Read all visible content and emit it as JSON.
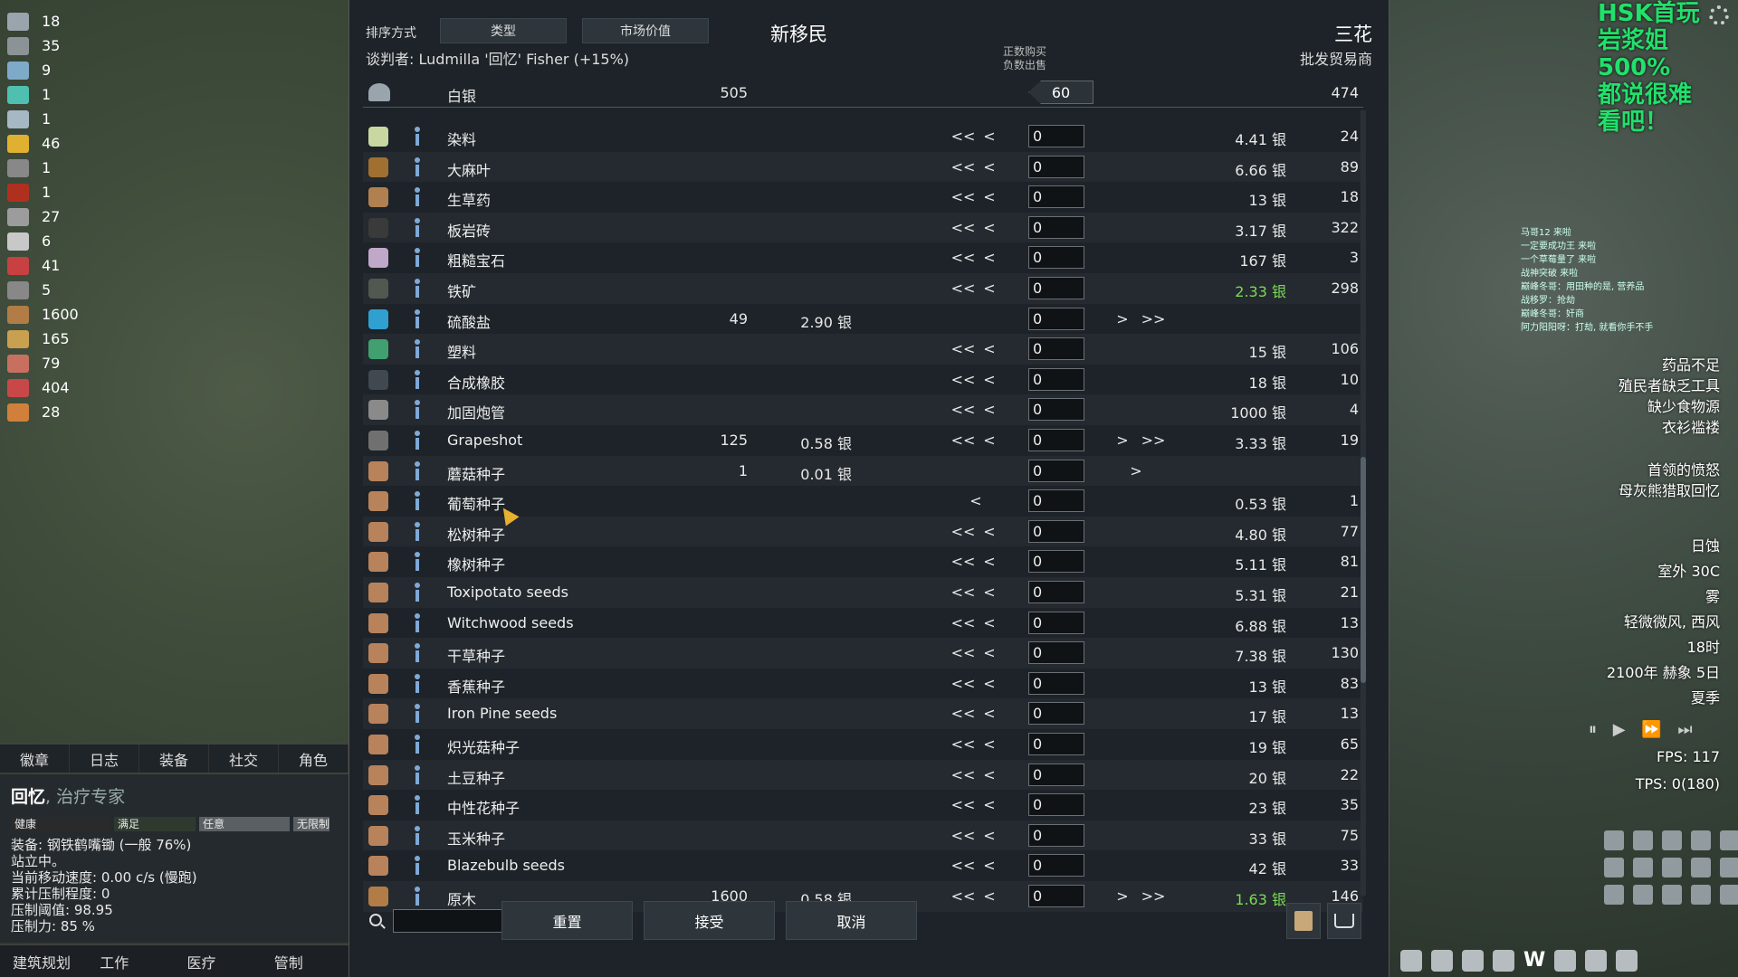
{
  "resources": [
    {
      "icon": "silver-icon",
      "count": "18",
      "color": "#9aa4ad"
    },
    {
      "icon": "steel-icon",
      "count": "35",
      "color": "#8c9396"
    },
    {
      "icon": "plasteel-icon",
      "count": "9",
      "color": "#7fa9c8"
    },
    {
      "icon": "components-icon",
      "count": "1",
      "color": "#4fc0b0"
    },
    {
      "icon": "adv-components-icon",
      "count": "1",
      "color": "#a5b8c4"
    },
    {
      "icon": "gold-icon",
      "count": "46",
      "color": "#e0b030"
    },
    {
      "icon": "chemfuel-icon",
      "count": "1",
      "color": "#888"
    },
    {
      "icon": "medicine-icon",
      "count": "1",
      "color": "#b03020"
    },
    {
      "icon": "weapon-icon",
      "count": "27",
      "color": "#9c9c9c"
    },
    {
      "icon": "apparel-icon",
      "count": "6",
      "color": "#c8c8c8"
    },
    {
      "icon": "meat-icon",
      "count": "41",
      "color": "#c84040"
    },
    {
      "icon": "misc-icon",
      "count": "5",
      "color": "#888"
    },
    {
      "icon": "wood-icon",
      "count": "1600",
      "color": "#b27c46"
    },
    {
      "icon": "hay-icon",
      "count": "165",
      "color": "#c8a050"
    },
    {
      "icon": "raw-food-icon",
      "count": "79",
      "color": "#c87060"
    },
    {
      "icon": "meat-raw-icon",
      "count": "404",
      "color": "#c84848"
    },
    {
      "icon": "egg-icon",
      "count": "28",
      "color": "#d0803a"
    }
  ],
  "left_tabs": [
    "徽章",
    "日志",
    "装备",
    "社交",
    "角色"
  ],
  "inspect": {
    "name": "回忆",
    "title": ", 治疗专家",
    "bars": [
      {
        "label": "健康",
        "color": "#2a2a2a"
      },
      {
        "label": "满足",
        "color": "#2f3a2f"
      },
      {
        "label": "任意",
        "color": "#5a5f63"
      },
      {
        "label": "无限制",
        "color": "#5a5f63"
      }
    ],
    "lines": [
      "装备: 钢铁鹤嘴锄 (一般 76%)",
      "站立中。",
      "当前移动速度: 0.00 c/s (慢跑)",
      "累计压制程度: 0",
      "压制阈值: 98.95",
      "压制力: 85 %"
    ]
  },
  "bottom_tabs": [
    "建筑规划",
    "工作",
    "医疗",
    "管制"
  ],
  "dialog": {
    "sort_label": "排序方式",
    "sort_buttons": [
      "类型",
      "市场价值"
    ],
    "title": "新移民",
    "trader": "三花",
    "negotiator": "谈判者: Ludmilla '回忆' Fisher (+15%)",
    "trader_kind": "批发贸易商",
    "buy_hint_1": "正数购买",
    "buy_hint_2": "负数出售",
    "silver": {
      "name": "白银",
      "left": "505",
      "value": "60",
      "right": "474"
    },
    "rows": [
      {
        "name": "染料",
        "icon": "#c8d8a0",
        "cl": "",
        "pl": "",
        "mode": "both-left",
        "price": "4.41 银",
        "cr": "24",
        "green": false
      },
      {
        "name": "大麻叶",
        "icon": "#a07030",
        "cl": "",
        "pl": "",
        "mode": "both-left",
        "price": "6.66 银",
        "cr": "89",
        "green": false
      },
      {
        "name": "生草药",
        "icon": "#b08050",
        "cl": "",
        "pl": "",
        "mode": "both-left",
        "price": "13 银",
        "cr": "18",
        "green": false
      },
      {
        "name": "板岩砖",
        "icon": "#3a3a3a",
        "cl": "",
        "pl": "",
        "mode": "both-left",
        "price": "3.17 银",
        "cr": "322",
        "green": false
      },
      {
        "name": "粗糙宝石",
        "icon": "#c0a8c8",
        "cl": "",
        "pl": "",
        "mode": "both-left",
        "price": "167 银",
        "cr": "3",
        "green": false
      },
      {
        "name": "铁矿",
        "icon": "#505850",
        "cl": "",
        "pl": "",
        "mode": "both-left",
        "price": "2.33 银",
        "cr": "298",
        "green": true
      },
      {
        "name": "硫酸盐",
        "icon": "#30a0d0",
        "cl": "49",
        "pl": "2.90 银",
        "mode": "right",
        "price": "",
        "cr": "",
        "green": false
      },
      {
        "name": "塑料",
        "icon": "#40a070",
        "cl": "",
        "pl": "",
        "mode": "both-left",
        "price": "15 银",
        "cr": "106",
        "green": false
      },
      {
        "name": "合成橡胶",
        "icon": "#404850",
        "cl": "",
        "pl": "",
        "mode": "both-left",
        "price": "18 银",
        "cr": "10",
        "green": false
      },
      {
        "name": "加固炮管",
        "icon": "#8a8a8a",
        "cl": "",
        "pl": "",
        "mode": "both-left",
        "price": "1000 银",
        "cr": "4",
        "green": false
      },
      {
        "name": "Grapeshot",
        "icon": "#707070",
        "cl": "125",
        "pl": "0.58 银",
        "mode": "all",
        "price": "3.33 银",
        "cr": "19",
        "green": false
      },
      {
        "name": "蘑菇种子",
        "icon": "#b8825a",
        "cl": "1",
        "pl": "0.01 银",
        "mode": "right-single",
        "price": "",
        "cr": "",
        "green": false
      },
      {
        "name": "葡萄种子",
        "icon": "#b8825a",
        "cl": "",
        "pl": "",
        "mode": "left-single",
        "price": "0.53 银",
        "cr": "1",
        "green": false
      },
      {
        "name": "松树种子",
        "icon": "#b8825a",
        "cl": "",
        "pl": "",
        "mode": "both-left",
        "price": "4.80 银",
        "cr": "77",
        "green": false
      },
      {
        "name": "橡树种子",
        "icon": "#b8825a",
        "cl": "",
        "pl": "",
        "mode": "both-left",
        "price": "5.11 银",
        "cr": "81",
        "green": false
      },
      {
        "name": "Toxipotato seeds",
        "icon": "#b8825a",
        "cl": "",
        "pl": "",
        "mode": "both-left",
        "price": "5.31 银",
        "cr": "21",
        "green": false
      },
      {
        "name": "Witchwood seeds",
        "icon": "#b8825a",
        "cl": "",
        "pl": "",
        "mode": "both-left",
        "price": "6.88 银",
        "cr": "13",
        "green": false
      },
      {
        "name": "干草种子",
        "icon": "#b8825a",
        "cl": "",
        "pl": "",
        "mode": "both-left",
        "price": "7.38 银",
        "cr": "130",
        "green": false
      },
      {
        "name": "香蕉种子",
        "icon": "#b8825a",
        "cl": "",
        "pl": "",
        "mode": "both-left",
        "price": "13 银",
        "cr": "83",
        "green": false
      },
      {
        "name": "Iron Pine seeds",
        "icon": "#b8825a",
        "cl": "",
        "pl": "",
        "mode": "both-left",
        "price": "17 银",
        "cr": "13",
        "green": false
      },
      {
        "name": "炽光菇种子",
        "icon": "#b8825a",
        "cl": "",
        "pl": "",
        "mode": "both-left",
        "price": "19 银",
        "cr": "65",
        "green": false
      },
      {
        "name": "土豆种子",
        "icon": "#b8825a",
        "cl": "",
        "pl": "",
        "mode": "both-left",
        "price": "20 银",
        "cr": "22",
        "green": false
      },
      {
        "name": "中性花种子",
        "icon": "#b8825a",
        "cl": "",
        "pl": "",
        "mode": "both-left",
        "price": "23 银",
        "cr": "35",
        "green": false
      },
      {
        "name": "玉米种子",
        "icon": "#b8825a",
        "cl": "",
        "pl": "",
        "mode": "both-left",
        "price": "33 银",
        "cr": "75",
        "green": false
      },
      {
        "name": "Blazebulb seeds",
        "icon": "#b8825a",
        "cl": "",
        "pl": "",
        "mode": "both-left",
        "price": "42 银",
        "cr": "33",
        "green": false
      },
      {
        "name": "原木",
        "icon": "#b27c46",
        "cl": "1600",
        "pl": "0.58 银",
        "mode": "all",
        "price": "1.63 银",
        "cr": "146",
        "green": true
      }
    ],
    "qty_default": "0",
    "buttons": {
      "reset": "重置",
      "accept": "接受",
      "cancel": "取消"
    }
  },
  "overlay": {
    "line1": "HSK首玩",
    "line2": "岩浆姐500%",
    "line3": "都说很难",
    "line4": "看吧！"
  },
  "chat": [
    "马哥12 来啦",
    "一定要成功王 来啦",
    "一个草莓量了 来啦",
    "战神突破 来啦",
    "巅峰冬哥：用田种的是, 营养品",
    "战移罗：抢劫",
    "巅峰冬哥：奸商",
    "阿力阳阳呀：打劫, 就看你手不手"
  ],
  "alerts": [
    "药品不足",
    "殖民者缺乏工具",
    "缺少食物源",
    "衣衫褴褛"
  ],
  "alerts2": [
    "首领的愤怒",
    "母灰熊猎取回忆"
  ],
  "weather": [
    "日蚀",
    "室外 30C",
    "雾",
    "轻微微风, 西风",
    "18时",
    "2100年 赫象 5日",
    "夏季"
  ],
  "fps": "FPS: 117",
  "tps": "TPS: 0(180)"
}
